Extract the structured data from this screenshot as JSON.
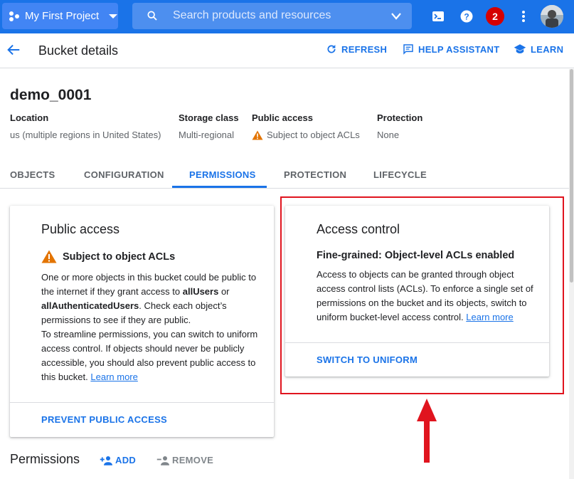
{
  "topbar": {
    "project_name": "My First Project",
    "search_placeholder": "Search products and resources",
    "notification_count": "2"
  },
  "header": {
    "title": "Bucket details",
    "refresh_label": "REFRESH",
    "help_label": "HELP ASSISTANT",
    "learn_label": "LEARN"
  },
  "bucket": {
    "name": "demo_0001",
    "fields": [
      {
        "label": "Location",
        "value": "us (multiple regions in United States)"
      },
      {
        "label": "Storage class",
        "value": "Multi-regional"
      },
      {
        "label": "Public access",
        "value": "Subject to object ACLs"
      },
      {
        "label": "Protection",
        "value": "None"
      }
    ]
  },
  "tabs": [
    "OBJECTS",
    "CONFIGURATION",
    "PERMISSIONS",
    "PROTECTION",
    "LIFECYCLE"
  ],
  "active_tab": "PERMISSIONS",
  "public_card": {
    "title": "Public access",
    "subtitle": "Subject to object ACLs",
    "p1_a": "One or more objects in this bucket could be public to the internet if they grant access to ",
    "p1_b": "allUsers",
    "p1_c": " or ",
    "p1_d": "allAuthenticatedUsers",
    "p1_e": ". Check each object’s permissions to see if they are public.",
    "p2": "To streamline permissions, you can switch to uniform access control. If objects should never be publicly accessible, you should also prevent public access to this bucket. ",
    "learn_more": "Learn more",
    "action": "PREVENT PUBLIC ACCESS"
  },
  "access_card": {
    "title": "Access control",
    "subtitle": "Fine-grained: Object-level ACLs enabled",
    "body": "Access to objects can be granted through object access control lists (ACLs). To enforce a single set of permissions on the bucket and its objects, switch to uniform bucket-level access control. ",
    "learn_more": "Learn more",
    "action": "SWITCH TO UNIFORM"
  },
  "permissions": {
    "title": "Permissions",
    "add_label": "ADD",
    "remove_label": "REMOVE"
  },
  "colors": {
    "brand": "#1a73e8",
    "warning": "#e37400",
    "highlight": "#e0141e"
  }
}
